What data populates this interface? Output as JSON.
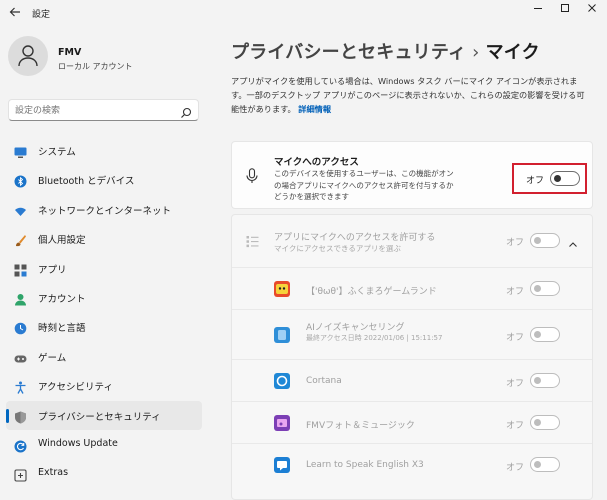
{
  "window": {
    "title": "設定"
  },
  "profile": {
    "name": "FMV",
    "account": "ローカル アカウント"
  },
  "search": {
    "placeholder": "設定の検索"
  },
  "sidebar": {
    "items": [
      {
        "label": "システム",
        "icon": "monitor-icon"
      },
      {
        "label": "Bluetooth とデバイス",
        "icon": "bluetooth-icon"
      },
      {
        "label": "ネットワークとインターネット",
        "icon": "wifi-icon"
      },
      {
        "label": "個人用設定",
        "icon": "brush-icon"
      },
      {
        "label": "アプリ",
        "icon": "apps-icon"
      },
      {
        "label": "アカウント",
        "icon": "person-icon"
      },
      {
        "label": "時刻と言語",
        "icon": "globe-clock-icon"
      },
      {
        "label": "ゲーム",
        "icon": "gamepad-icon"
      },
      {
        "label": "アクセシビリティ",
        "icon": "accessibility-icon"
      },
      {
        "label": "プライバシーとセキュリティ",
        "icon": "shield-icon",
        "active": true
      },
      {
        "label": "Windows Update",
        "icon": "update-icon"
      },
      {
        "label": "Extras",
        "icon": "extras-icon"
      }
    ]
  },
  "breadcrumb": {
    "parent": "プライバシーとセキュリティ",
    "separator": "›",
    "current": "マイク"
  },
  "description": {
    "text": "アプリがマイクを使用している場合は、Windows タスク バーにマイク アイコンが表示されます。一部のデスクトップ アプリがこのページに表示されないか、これらの設定の影響を受ける可能性があります。",
    "link": "詳細情報"
  },
  "mic_access": {
    "title": "マイクへのアクセス",
    "description": "このデバイスを使用するユーザーは、この機能がオンの場合アプリにマイクへのアクセス許可を付与するかどうかを選択できます",
    "state_label": "オフ"
  },
  "app_access": {
    "title": "アプリにマイクへのアクセスを許可する",
    "subtitle": "マイクにアクセスできるアプリを選ぶ",
    "state_label": "オフ"
  },
  "apps": [
    {
      "name": "【'θωθ'】ふくまろゲームランド",
      "sub": "",
      "state": "オフ",
      "color": "#e84a2a"
    },
    {
      "name": "AIノイズキャンセリング",
      "sub": "最終アクセス日時 2022/01/06 | 15:11:57",
      "state": "オフ",
      "color": "#2f8fd8"
    },
    {
      "name": "Cortana",
      "sub": "",
      "state": "オフ",
      "color": "#1f88d6"
    },
    {
      "name": "FMVフォト＆ミュージック",
      "sub": "",
      "state": "オフ",
      "color": "#7c3fb5"
    },
    {
      "name": "Learn to Speak English X3",
      "sub": "",
      "state": "オフ",
      "color": "#1c7fd4"
    }
  ],
  "colors": {
    "accent": "#0067c0",
    "highlight_border": "#d2202f",
    "link": "#0060b8"
  }
}
